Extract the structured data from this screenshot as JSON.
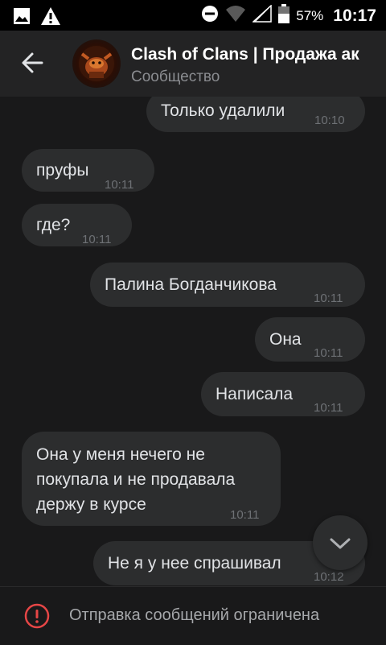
{
  "status": {
    "battery": "57%",
    "time": "10:17"
  },
  "header": {
    "title": "Clash of Clans | Продажа ак",
    "subtitle": "Сообщество"
  },
  "messages": [
    {
      "text": "Только удалили",
      "time": "10:10",
      "side": "out"
    },
    {
      "text": "пруфы",
      "time": "10:11",
      "side": "in"
    },
    {
      "text": "где?",
      "time": "10:11",
      "side": "in"
    },
    {
      "text": "Палина Богданчикова",
      "time": "10:11",
      "side": "out"
    },
    {
      "text": "Она",
      "time": "10:11",
      "side": "out"
    },
    {
      "text": "Написала",
      "time": "10:11",
      "side": "out"
    },
    {
      "lines": [
        "Она у меня нечего не",
        "покупала и не продавала",
        "держу в курсе"
      ],
      "time": "10:11",
      "side": "in"
    },
    {
      "text": "Не я у нее спрашивал",
      "time": "10:12",
      "side": "out"
    }
  ],
  "footer": {
    "text": "Отправка сообщений ограничена"
  },
  "icons": {
    "status": [
      "image-icon",
      "warning-icon",
      "do-not-disturb-icon",
      "wifi-icon",
      "signal-icon",
      "battery-icon"
    ],
    "header": [
      "back-arrow-icon"
    ],
    "scroll": "chevron-down-icon",
    "footer": "error-icon"
  },
  "colors": {
    "background": "#19191a",
    "bubble": "#2c2d2e",
    "header": "#232324",
    "error": "#e64646"
  }
}
